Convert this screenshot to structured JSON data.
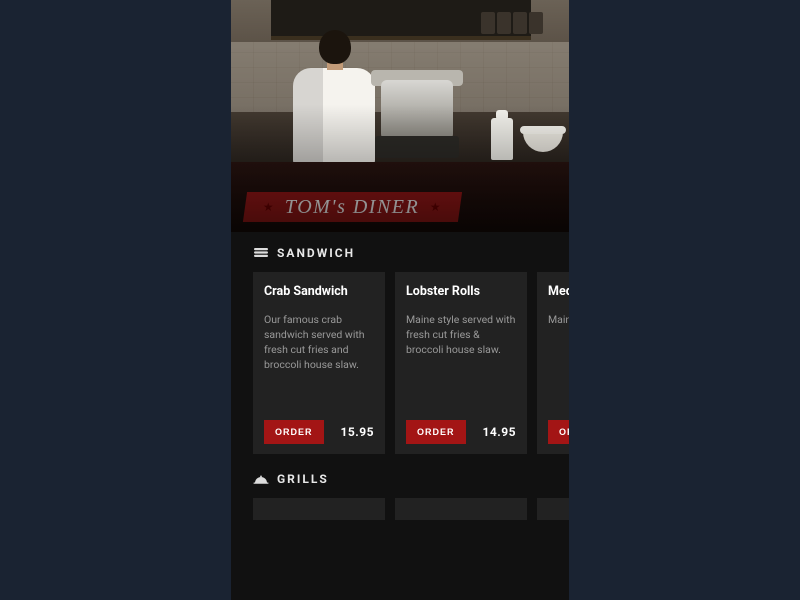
{
  "hero": {
    "title": "TOM's DINER"
  },
  "order_label": "ORDER",
  "sections": [
    {
      "id": "sandwich",
      "label": "SANDWICH",
      "icon": "sandwich-icon",
      "items": [
        {
          "name": "Crab Sandwich",
          "desc": "Our famous crab sandwich served with fresh cut fries and broccoli house slaw.",
          "price": "15.95"
        },
        {
          "name": "Lobster Rolls",
          "desc": "Maine style served with fresh cut fries & broccoli house slaw.",
          "price": "14.95"
        },
        {
          "name": "Medi Shrimp",
          "desc": "Main with & bro slaw.",
          "price": ""
        }
      ]
    },
    {
      "id": "grills",
      "label": "GRILLS",
      "icon": "dome-icon",
      "items": [
        {
          "name": "",
          "desc": "",
          "price": ""
        },
        {
          "name": "",
          "desc": "",
          "price": ""
        },
        {
          "name": "",
          "desc": "",
          "price": ""
        }
      ]
    }
  ]
}
